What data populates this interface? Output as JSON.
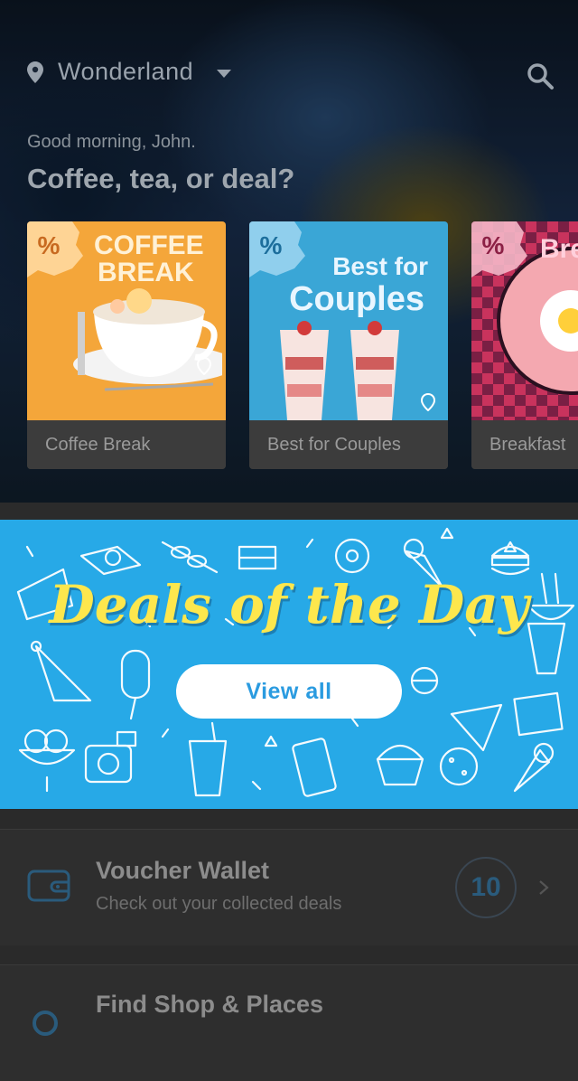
{
  "header": {
    "location": "Wonderland",
    "greeting": "Good morning, John.",
    "headline": "Coffee, tea, or deal?"
  },
  "categories": [
    {
      "label": "Coffee Break",
      "art_text": [
        "COFFEE",
        "BREAK"
      ],
      "art_color": "#f4a63a",
      "badge": "%"
    },
    {
      "label": "Best for Couples",
      "art_text": [
        "Best for",
        "Couples"
      ],
      "art_color": "#3aa6d6",
      "badge": "%"
    },
    {
      "label": "Breakfast",
      "art_text": [
        "Bre"
      ],
      "art_color": "#c9335d",
      "badge": "%"
    }
  ],
  "banner": {
    "title": "Deals of the Day",
    "button_label": "View all",
    "background": "#27a9e7",
    "title_color": "#fde74d"
  },
  "list": [
    {
      "title": "Voucher Wallet",
      "subtitle": "Check out your collected deals",
      "count": "10",
      "icon": "wallet-icon"
    },
    {
      "title": "Find Shop & Places",
      "icon": "search-icon"
    }
  ]
}
